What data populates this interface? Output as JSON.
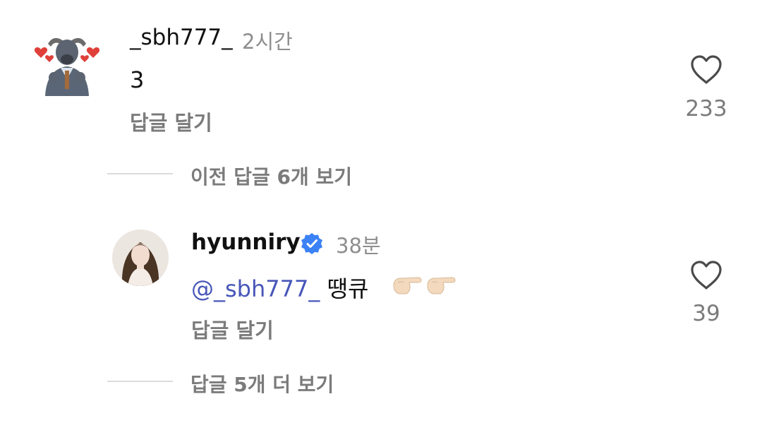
{
  "comments": [
    {
      "username": "_sbh777_",
      "time": "2시간",
      "text": "3",
      "reply_label": "답글 달기",
      "like_count": "233",
      "avatar_icon": "buffalo-hearts-avatar"
    }
  ],
  "view_previous": "이전 답글 6개 보기",
  "reply": {
    "username": "hyunniry",
    "verified": true,
    "time": "38분",
    "mention": "@_sbh777_",
    "text": "땡큐",
    "emoji": "pointing-hand-emoji x2",
    "reply_label": "답글 달기",
    "like_count": "39",
    "avatar_icon": "woman-portrait-avatar"
  },
  "view_more": "답글 5개 더 보기",
  "colors": {
    "mention": "#4756b8",
    "verified": "#3b82f6",
    "muted": "#8e8e8e",
    "divider": "#dbdbdb"
  }
}
